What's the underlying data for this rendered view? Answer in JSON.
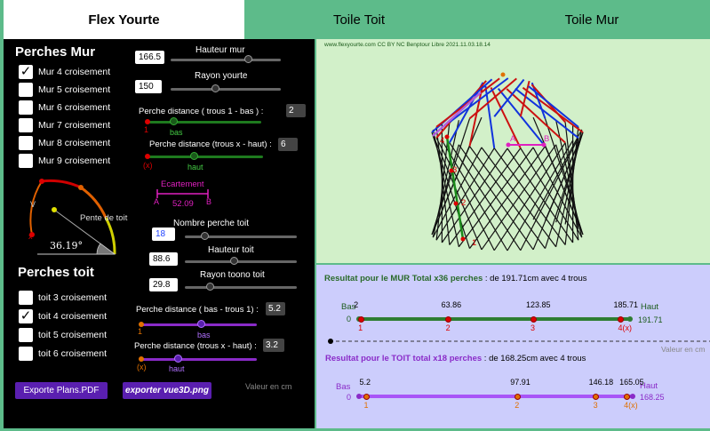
{
  "tabs": [
    {
      "label": "Flex Yourte"
    },
    {
      "label": "Toile Toit"
    },
    {
      "label": "Toile Mur"
    }
  ],
  "left": {
    "perches_mur_title": "Perches Mur",
    "mur_options": [
      {
        "label": "Mur 4 croisement",
        "checked": true
      },
      {
        "label": "Mur 5 croisement",
        "checked": false
      },
      {
        "label": "Mur 6 croisement",
        "checked": false
      },
      {
        "label": "Mur 7 croisement",
        "checked": false
      },
      {
        "label": "Mur 8 croisement",
        "checked": false
      },
      {
        "label": "Mur 9 croisement",
        "checked": false
      }
    ],
    "hauteur_mur": {
      "label": "Hauteur mur",
      "value": "166.5"
    },
    "rayon_yourte": {
      "label": "Rayon yourte",
      "value": "150"
    },
    "perche_distance_bas": {
      "label": "Perche distance ( trous 1 - bas ) :",
      "value": "2",
      "mark_1": "1",
      "mark_bas": "bas"
    },
    "perche_distance_haut": {
      "label": "Perche distance (trous x - haut) :",
      "value": "6",
      "mark_x": "(x)",
      "mark_haut": "haut"
    },
    "ecartement": {
      "label": "Ecartement",
      "a": "A",
      "b": "B",
      "value": "52.09"
    },
    "angle": {
      "label": "Pente de toit",
      "value": "36.19°",
      "v": "V",
      "x": "x"
    },
    "nombre_perche_toit": {
      "label": "Nombre perche toit",
      "value": "18"
    },
    "hauteur_toit": {
      "label": "Hauteur toit",
      "value": "88.6"
    },
    "rayon_toono_toit": {
      "label": "Rayon toono toit",
      "value": "29.8"
    },
    "perches_toit_title": "Perches toit",
    "toit_options": [
      {
        "label": "toit 3 croisement",
        "checked": false
      },
      {
        "label": "toit 4 croisement",
        "checked": true
      },
      {
        "label": "toit 5 croisement",
        "checked": false
      },
      {
        "label": "toit 6 croisement",
        "checked": false
      }
    ],
    "toit_distance_bas": {
      "label": "Perche distance ( bas - trous 1) :",
      "value": "5.2",
      "mark_1": "1",
      "mark_bas": "bas"
    },
    "toit_distance_haut": {
      "label": "Perche distance (trous x - haut) :",
      "value": "3.2",
      "mark_x": "(x)",
      "mark_haut": "haut"
    },
    "export_pdf": "Exporte Plans.PDF",
    "export_png": "exporter vue3D.png",
    "unit_note": "Valeur en cm"
  },
  "view3d": {
    "credit": "www.flexyourte.com CC BY NC Benptour Libre 2021.11.03.18.14",
    "labels": {
      "a": "A",
      "b": "B",
      "p1": "1",
      "p2": "2",
      "p3": "3",
      "p4": "4"
    }
  },
  "results": {
    "mur": {
      "title_bold": "Resultat pour le  MUR Total x36 perches",
      "title_rest": " : de 191.71cm avec 4 trous",
      "bas": "Bas",
      "haut": "Haut",
      "zero": "0",
      "end": "191.71",
      "points": [
        {
          "value": "2",
          "num": "1",
          "fraction": 0.0104
        },
        {
          "value": "63.86",
          "num": "2",
          "fraction": 0.333
        },
        {
          "value": "123.85",
          "num": "3",
          "fraction": 0.646
        },
        {
          "value": "185.71",
          "num": "4(x)",
          "fraction": 0.9687
        }
      ]
    },
    "unit_note": "Valeur en cm",
    "toit": {
      "title_bold": "Resultat pour le TOIT total x18 perches",
      "title_rest": " : de 168.25cm avec 4 trous",
      "bas": "Bas",
      "haut": "Haut",
      "zero": "0",
      "end": "168.25",
      "points": [
        {
          "value": "5.2",
          "num": "1",
          "fraction": 0.0309
        },
        {
          "value": "97.91",
          "num": "2",
          "fraction": 0.582
        },
        {
          "value": "146.18",
          "num": "3",
          "fraction": 0.869
        },
        {
          "value": "165.05",
          "num": "4(x)",
          "fraction": 0.981
        }
      ]
    }
  },
  "colors": {
    "accent_green": "#5dbb8a",
    "purple": "#8a2bc8",
    "dark_green": "#2e7d32"
  }
}
